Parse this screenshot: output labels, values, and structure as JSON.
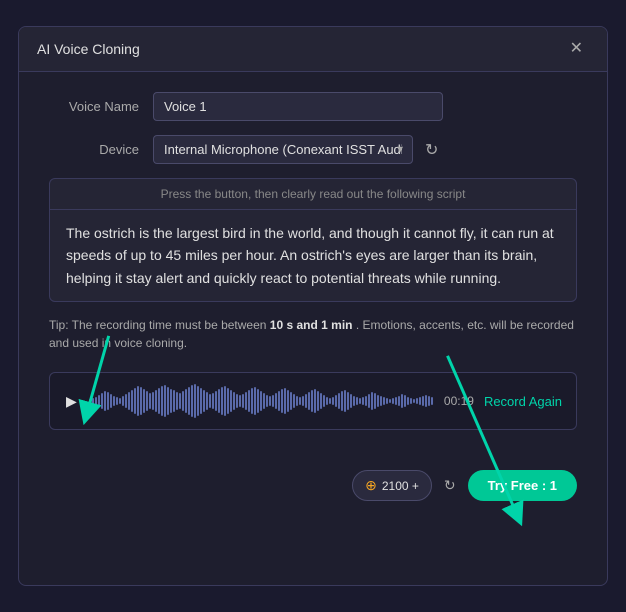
{
  "dialog": {
    "title": "AI Voice Cloning",
    "close_label": "✕"
  },
  "form": {
    "voice_name_label": "Voice Name",
    "voice_name_value": "Voice 1",
    "device_label": "Device",
    "device_value": "Internal Microphone (Conexant ISST Audio)"
  },
  "script": {
    "hint": "Press the button, then clearly read out the following script",
    "text": "The ostrich is the largest bird in the world, and though it cannot fly, it can run at speeds of up to 45 miles per hour. An ostrich's eyes are larger than its brain, helping it stay alert and quickly react to potential threats while running."
  },
  "tip": {
    "prefix": "Tip: The recording time must be between ",
    "bold_part": "10 s and 1 min",
    "suffix": " . Emotions, accents, etc. will be recorded and used in voice cloning."
  },
  "waveform": {
    "time": "00:19",
    "record_again_label": "Record Again"
  },
  "footer": {
    "credits_label": "2100 +",
    "try_free_label": "Try Free : 1"
  }
}
